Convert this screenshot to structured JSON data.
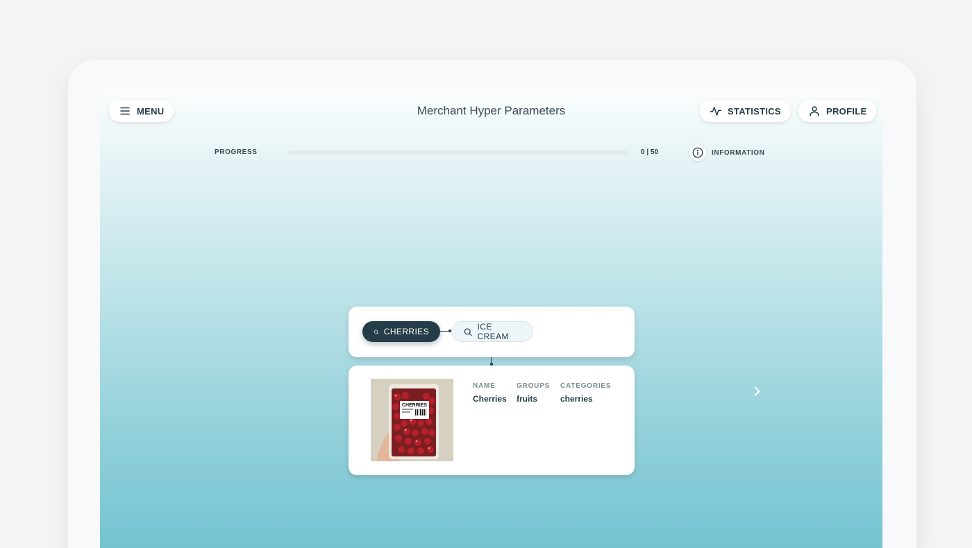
{
  "header": {
    "title": "Merchant Hyper Parameters",
    "menu_label": "MENU",
    "statistics_label": "STATISTICS",
    "profile_label": "PROFILE"
  },
  "progress": {
    "label": "PROGRESS",
    "current": 0,
    "total": 50,
    "count_text": "0 | 50",
    "information_label": "INFORMATION"
  },
  "search_chips": [
    {
      "label": "CHERRIES",
      "active": true,
      "icon": "search-icon"
    },
    {
      "label": "ICE CREAM",
      "active": false,
      "icon": "search-icon"
    }
  ],
  "product": {
    "image_label": "CHERRIES",
    "fields": [
      {
        "label": "NAME",
        "value": "Cherries"
      },
      {
        "label": "GROUPS",
        "value": "fruits"
      },
      {
        "label": "CATEGORIES",
        "value": "cherries"
      }
    ]
  },
  "icons": {
    "menu": "hamburger-icon",
    "statistics": "activity-icon",
    "profile": "user-icon",
    "information": "info-icon",
    "next": "chevron-right-icon"
  },
  "colors": {
    "primary": "#243d48",
    "gradient_top": "#fbfdfd",
    "gradient_bottom": "#74c4d2",
    "card": "#ffffff"
  }
}
